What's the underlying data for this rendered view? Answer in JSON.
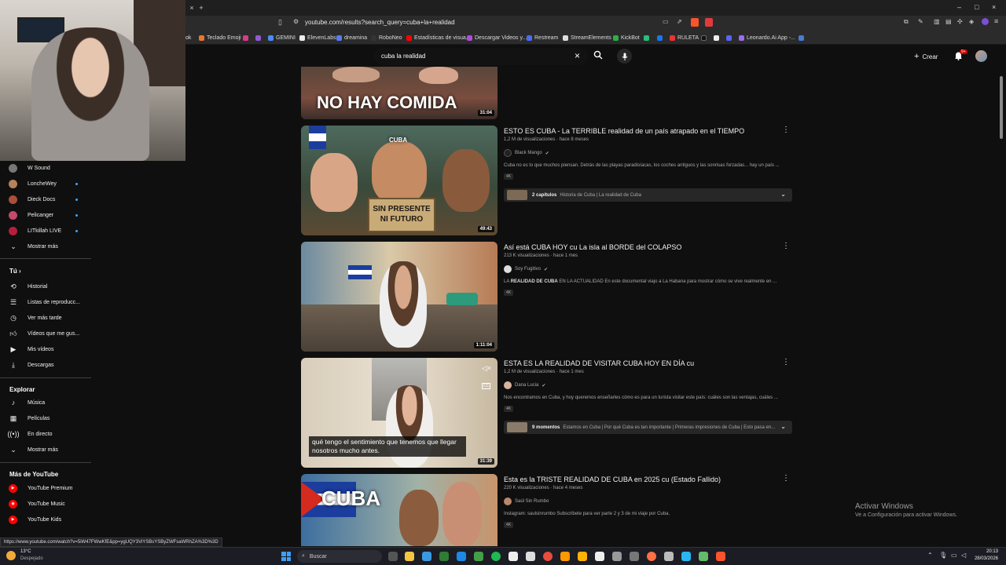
{
  "browser": {
    "url": "youtube.com/results?search_query=cuba+la+realidad",
    "status_url": "https://www.youtube.com/watch?v=5iW47FWwKfE&pp=ygUQY3ViYSBsYSByZWFsaWRhZA%3D%3D",
    "bookmarks": [
      "Teclado Emoji",
      "GEMINI",
      "ElevenLabs",
      "dreamina",
      "RoboNeo",
      "Estadísticas de visua...",
      "Descargar Videos y...",
      "Restream",
      "StreamElements",
      "KickBot",
      "RULETA",
      "Leonardo.Ai App -..."
    ],
    "bookmark_first_fragment": "ok",
    "tab_close": "×",
    "tab_new": "+",
    "window_controls": [
      "–",
      "□",
      "×"
    ]
  },
  "header": {
    "search_query": "cuba la realidad",
    "create_label": "Crear",
    "notif_count": "9+"
  },
  "sidebar": {
    "subscriptions": [
      {
        "label": "W Sound",
        "color": "#777777",
        "dot": false
      },
      {
        "label": "LoncheWey",
        "color": "#b5835a",
        "dot": true
      },
      {
        "label": "Dieck Docs",
        "color": "#a94f3a",
        "dot": true
      },
      {
        "label": "Pelicanger",
        "color": "#c24a6b",
        "dot": true
      },
      {
        "label": "LITkillah LIVE",
        "color": "#b51e3c",
        "dot": true
      }
    ],
    "show_more": "Mostrar más",
    "you_heading": "Tú",
    "you_items": [
      "Historial",
      "Listas de reproducc...",
      "Ver más tarde",
      "Vídeos que me gus...",
      "Mis vídeos",
      "Descargas"
    ],
    "explore_heading": "Explorar",
    "explore_items": [
      "Música",
      "Películas",
      "En directo",
      "Mostrar más"
    ],
    "more_heading": "Más de YouTube",
    "more_items": [
      "YouTube Premium",
      "YouTube Music",
      "YouTube Kids"
    ]
  },
  "videos": [
    {
      "thumb_text": "NO HAY COMIDA",
      "duration": "31:04"
    },
    {
      "title": "ESTO ES CUBA - La TERRIBLE realidad de un país atrapado en el TIEMPO",
      "meta": "1,2 M de visualizaciones · hace 8 meses",
      "channel": "Black Mango",
      "description": "Cuba no es lo que muchos piensan. Detrás de las playas paradisíacas, los coches antiguos y las sonrisas forzadas... hay un país ...",
      "badge": "4K",
      "chapters_count": "2 capítulos",
      "chapters_text": "Historia de Cuba | La realidad de Cuba",
      "duration": "49:43",
      "thumb_text_top": "CUBA",
      "thumb_text_sign": "SIN PRESENTE NI FUTURO"
    },
    {
      "title": "Así está CUBA HOY cu La isla al BORDE del COLAPSO",
      "meta": "213 K visualizaciones · hace 1 mes",
      "channel": "Soy Fugitivo",
      "description_pre": "LA ",
      "description_bold": "REALIDAD DE CUBA",
      "description_post": " EN LA ACTUALIDAD En este documental viajo a La Habana para mostrar cómo se vive realmente en ...",
      "badge": "4K",
      "duration": "1:11:04"
    },
    {
      "title": "ESTA ES LA REALIDAD DE VISITAR CUBA HOY EN DÍA cu",
      "meta": "1,2 M de visualizaciones · hace 1 mes",
      "channel": "Dana Lucia",
      "description": "Nos encontramos en Cuba, y hoy queremos enseñarles cómo es para un turista visitar este país: cuáles son las ventajas, cuáles ...",
      "badge": "4K",
      "chapters_count": "9 momentos",
      "chapters_text": "Estamos en Cuba | Por qué Cuba es tan importante | Primeras impresiones de Cuba | Esto pasa en...",
      "duration": "31:39",
      "subtitle": "qué tengo el sentimiento que tenemos que llegar nosotros mucho antes.",
      "cc": "CC"
    },
    {
      "title": "Esta es la TRISTE REALIDAD DE CUBA en 2025 cu (Estado Fallido)",
      "meta": "220 K visualizaciones · hace 4 meses",
      "channel": "Saúl Sin Rumbo",
      "description": "Instagram: saulsinrumbo Subscribete para ver parte 2 y 3 de mi viaje por Cuba.",
      "badge": "4K",
      "thumb_text": "CUBA"
    }
  ],
  "watermark": {
    "line1": "Activar Windows",
    "line2": "Ve a Configuración para activar Windows."
  },
  "taskbar": {
    "weather_temp": "13°C",
    "weather_desc": "Despejado",
    "search_placeholder": "Buscar",
    "time": "20:13",
    "date": "28/03/2026"
  }
}
